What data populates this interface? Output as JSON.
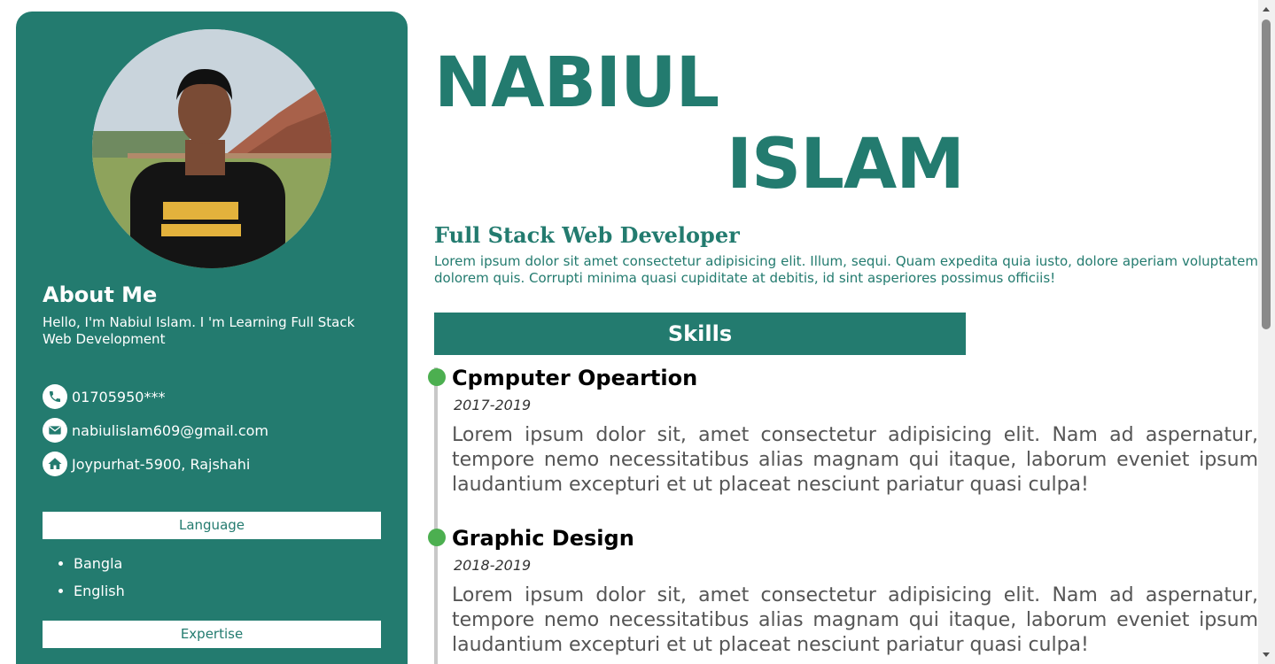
{
  "colors": {
    "primary": "#237b6f",
    "timeline_dot": "#4caf50",
    "timeline_line": "#c8c8c8"
  },
  "sidebar": {
    "about_title": "About Me",
    "about_text": "Hello, I'm Nabiul Islam. I 'm Learning Full Stack Web Development",
    "contacts": [
      {
        "icon": "phone-icon",
        "text": "01705950***"
      },
      {
        "icon": "email-icon",
        "text": "nabiulislam609@gmail.com"
      },
      {
        "icon": "home-icon",
        "text": "Joypurhat-5900, Rajshahi"
      }
    ],
    "language_title": "Language",
    "languages": [
      "Bangla",
      "English"
    ],
    "expertise_title": "Expertise"
  },
  "main": {
    "name_first": "NABIUL",
    "name_last": "ISLAM",
    "job_title": "Full Stack Web Developer",
    "job_desc": "Lorem ipsum dolor sit amet consectetur adipisicing elit. Illum, sequi. Quam expedita quia iusto, dolore aperiam voluptatem dolorem quis. Corrupti minima quasi cupiditate at debitis, id sint asperiores possimus officiis!",
    "skills_title": "Skills",
    "skills": [
      {
        "title": "Cpmputer Opeartion",
        "date": "2017-2019",
        "desc": "Lorem ipsum dolor sit, amet consectetur adipisicing elit. Nam ad aspernatur, tempore nemo necessitatibus alias magnam qui itaque, laborum eveniet ipsum laudantium excepturi et ut placeat nesciunt pariatur quasi culpa!"
      },
      {
        "title": "Graphic Design",
        "date": "2018-2019",
        "desc": "Lorem ipsum dolor sit, amet consectetur adipisicing elit. Nam ad aspernatur, tempore nemo necessitatibus alias magnam qui itaque, laborum eveniet ipsum laudantium excepturi et ut placeat nesciunt pariatur quasi culpa!"
      }
    ]
  }
}
